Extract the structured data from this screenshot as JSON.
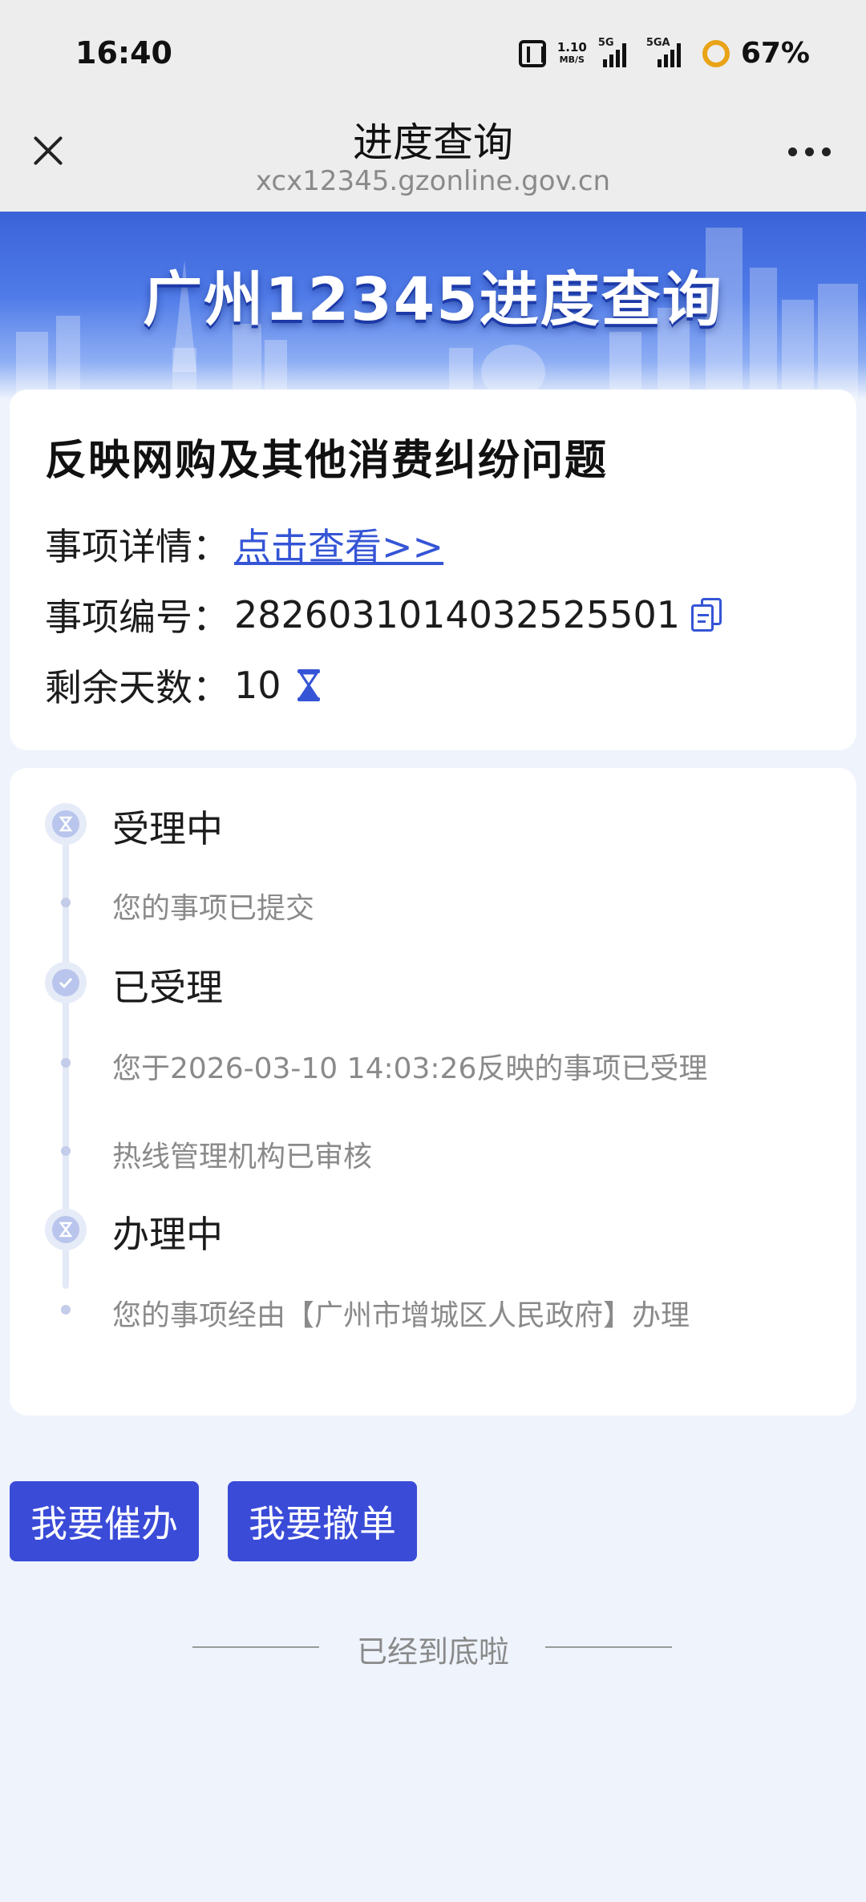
{
  "status_bar": {
    "time": "16:40",
    "speed_value": "1.10",
    "speed_unit": "MB/S",
    "sig1_label": "5G",
    "sig2_label": "5GA",
    "battery": "67%"
  },
  "nav": {
    "title": "进度查询",
    "url": "xcx12345.gzonline.gov.cn"
  },
  "banner": {
    "title": "广州12345进度查询"
  },
  "info": {
    "heading": "反映网购及其他消费纠纷问题",
    "detail_label": "事项详情：",
    "detail_link": "点击查看>>",
    "number_label": "事项编号：",
    "number_value": "2826031014032525501",
    "days_label": "剩余天数：",
    "days_value": "10"
  },
  "timeline": [
    {
      "title": "受理中",
      "icon": "hourglass-icon",
      "items": [
        "您的事项已提交"
      ]
    },
    {
      "title": "已受理",
      "icon": "check-icon",
      "items": [
        "您于2026-03-10 14:03:26反映的事项已受理",
        "热线管理机构已审核"
      ]
    },
    {
      "title": "办理中",
      "icon": "hourglass-icon",
      "items": [
        "您的事项经由【广州市增城区人民政府】办理"
      ]
    }
  ],
  "buttons": {
    "urge": "我要催办",
    "cancel": "我要撤单"
  },
  "footer": {
    "end_text": "已经到底啦"
  },
  "colors": {
    "accent": "#3a4bd8",
    "link": "#3555d6",
    "page_bg": "#eef3fc"
  }
}
